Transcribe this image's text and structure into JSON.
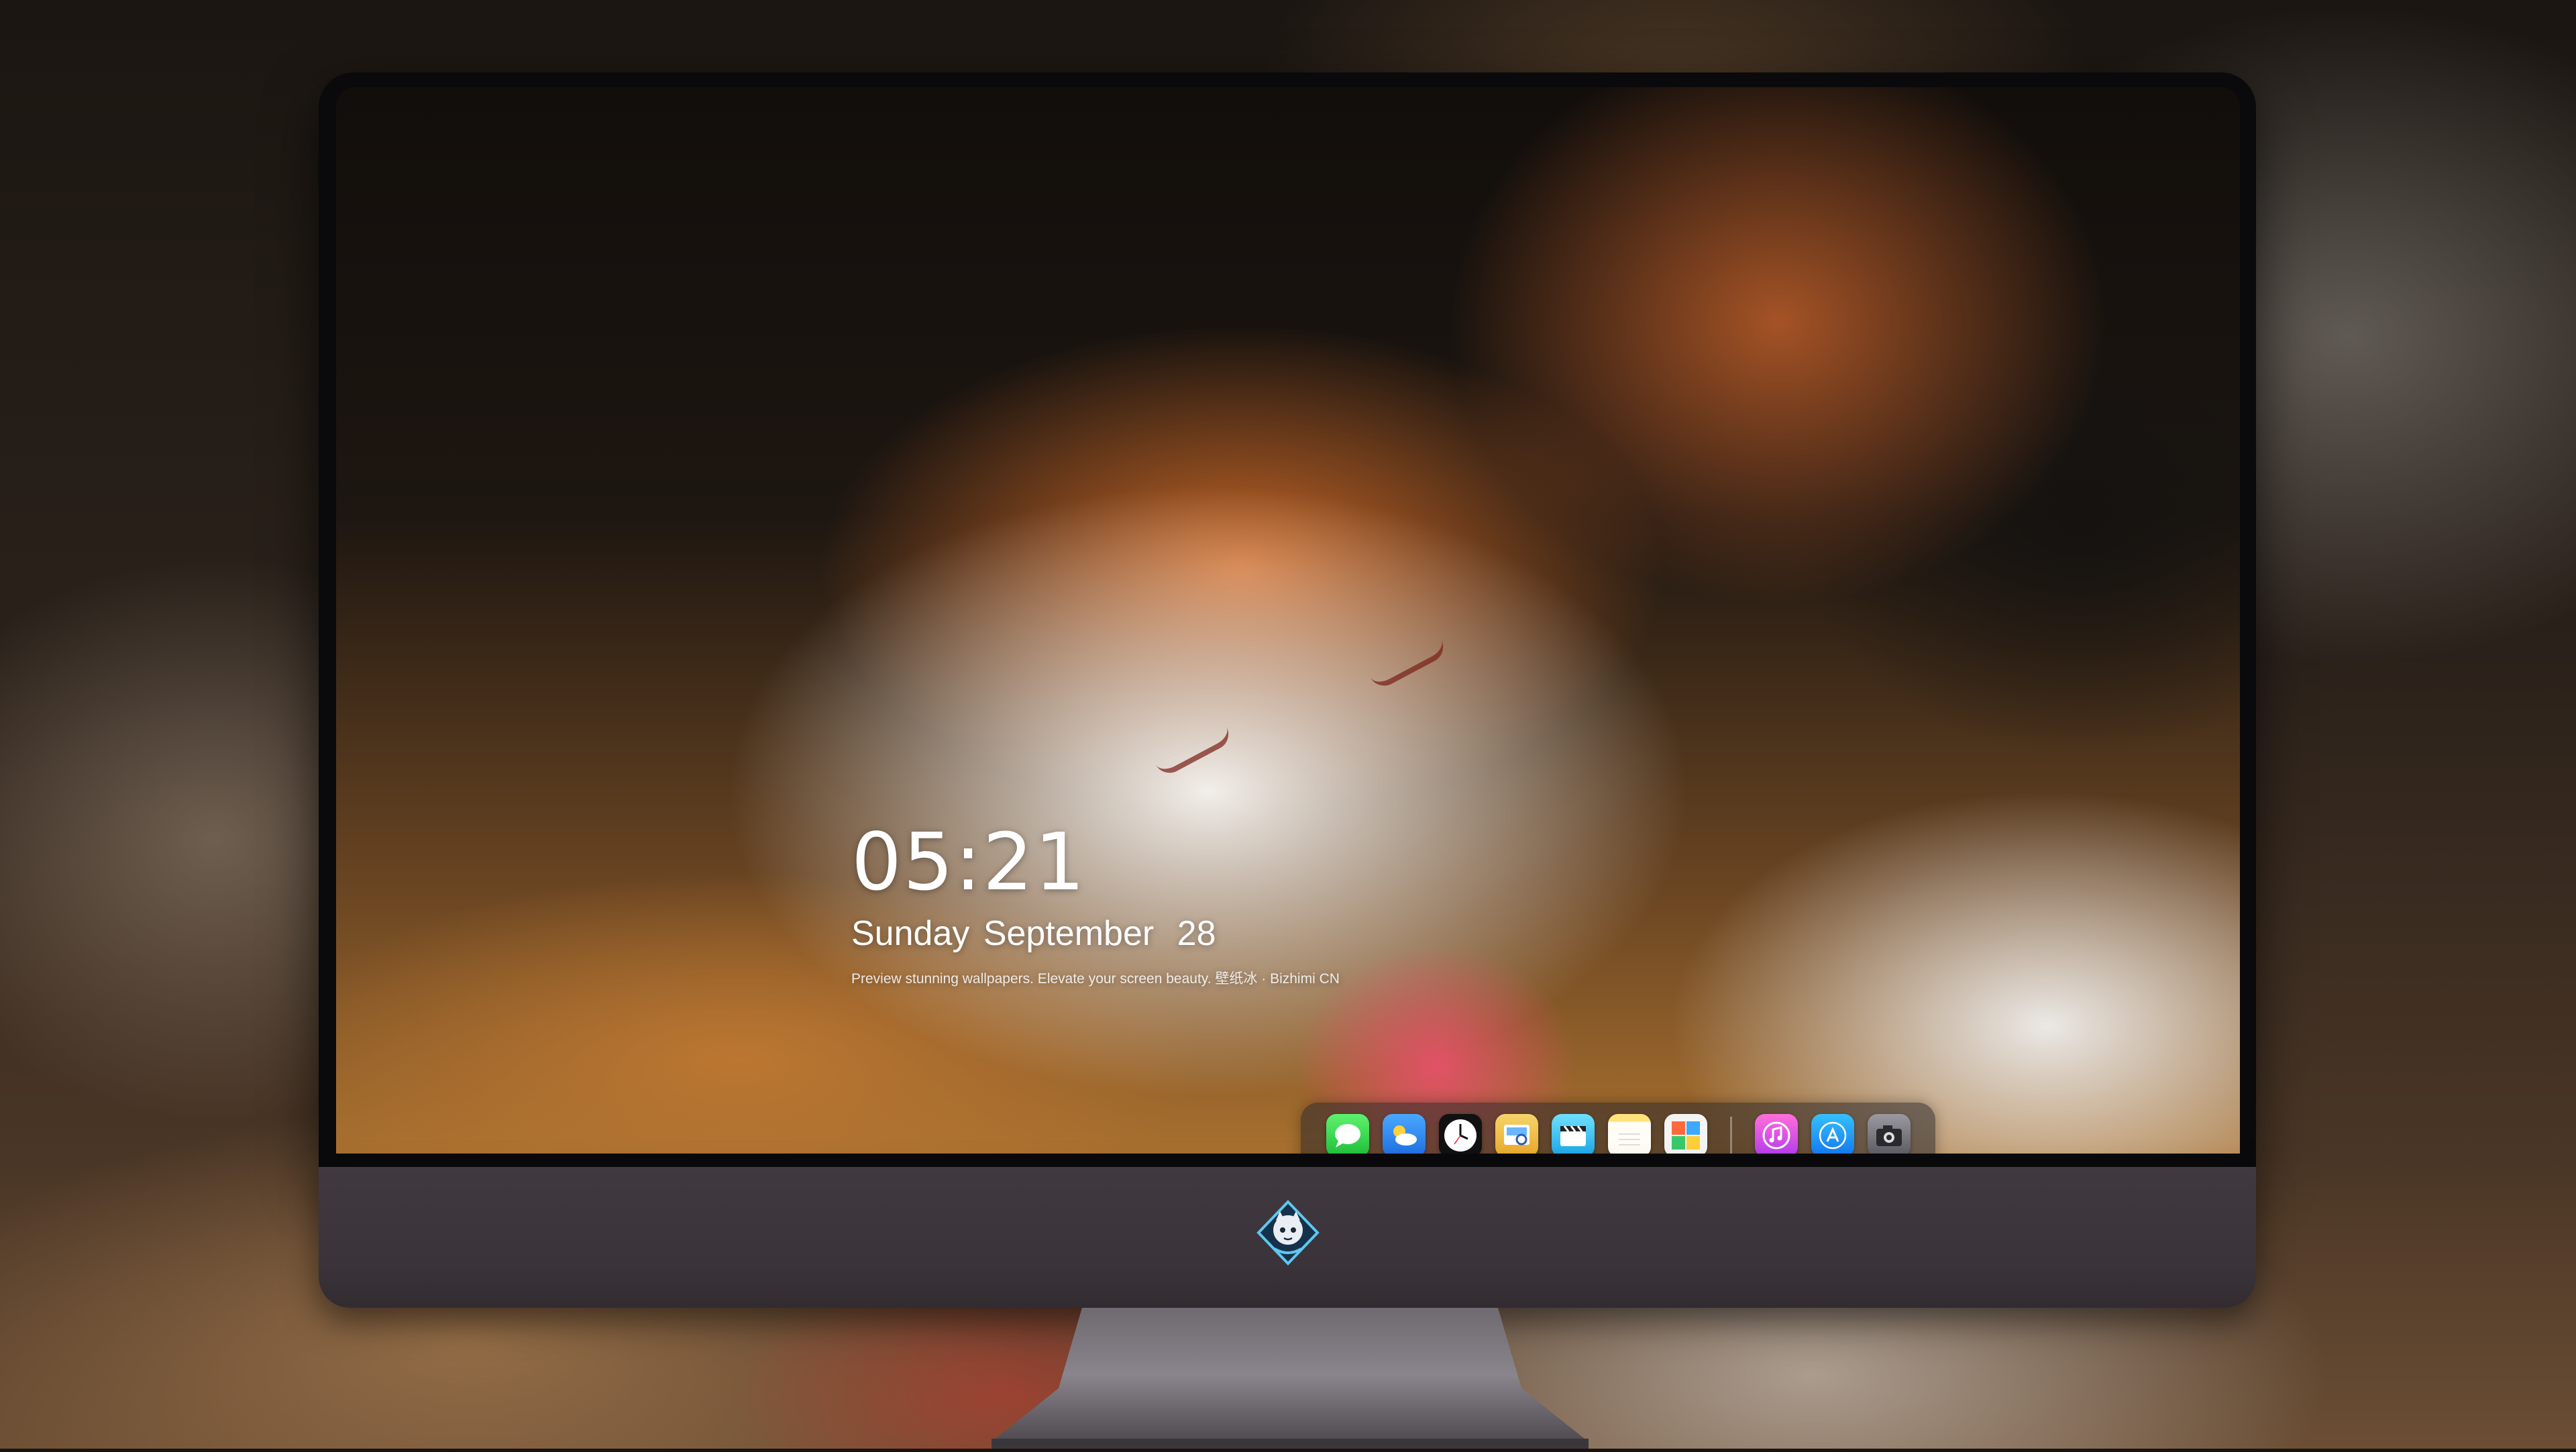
{
  "lock_screen": {
    "time": "05:21",
    "weekday": "Sunday",
    "month": "September",
    "day": "28",
    "tagline": "Preview stunning wallpapers. Elevate your screen beauty. 壁纸冰 · Bizhimi CN"
  },
  "dock": {
    "apps": [
      {
        "name": "Messages",
        "icon": "messages-icon"
      },
      {
        "name": "Weather",
        "icon": "weather-icon"
      },
      {
        "name": "Clock",
        "icon": "clock-icon"
      },
      {
        "name": "Preview",
        "icon": "preview-icon"
      },
      {
        "name": "Clips",
        "icon": "clips-icon"
      },
      {
        "name": "Notes",
        "icon": "notes-icon"
      },
      {
        "name": "Photo Booth",
        "icon": "photo-booth-icon"
      },
      {
        "name": "iTunes",
        "icon": "itunes-icon"
      },
      {
        "name": "App Store",
        "icon": "app-store-icon"
      },
      {
        "name": "Camera",
        "icon": "camera-icon"
      }
    ]
  },
  "colors": {
    "bezel": "#0a0a0c",
    "chin": "#3d363c",
    "dock_bg": "rgba(40,38,42,0.55)",
    "text": "#ffffff"
  }
}
